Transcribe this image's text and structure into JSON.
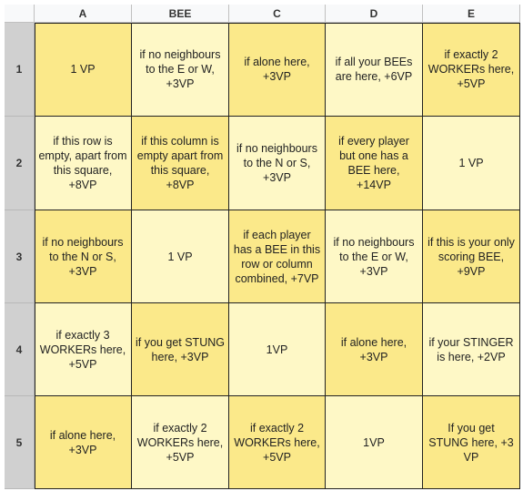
{
  "colors": {
    "dark_yellow": "#fbe98a",
    "light_yellow": "#fef8c6",
    "header_bg": "#f8f9fa",
    "row_header_bg": "#d0d0d0"
  },
  "columns": [
    "A",
    "BEE",
    "C",
    "D",
    "E"
  ],
  "rows": [
    "1",
    "2",
    "3",
    "4",
    "5"
  ],
  "cells": [
    [
      {
        "text": "1 VP",
        "shade": "dark"
      },
      {
        "text": "if no neighbours to the E or W, +3VP",
        "shade": "light"
      },
      {
        "text": "if alone here, +3VP",
        "shade": "dark"
      },
      {
        "text": "if all your BEEs are here, +6VP",
        "shade": "light"
      },
      {
        "text": "if exactly 2 WORKERs here, +5VP",
        "shade": "dark"
      }
    ],
    [
      {
        "text": "if this row is empty, apart from this square, +8VP",
        "shade": "light"
      },
      {
        "text": "if this column is empty apart from this square, +8VP",
        "shade": "dark"
      },
      {
        "text": "if no neighbours to the N or S, +3VP",
        "shade": "light"
      },
      {
        "text": "if every player but one has a BEE here, +14VP",
        "shade": "dark"
      },
      {
        "text": "1 VP",
        "shade": "light"
      }
    ],
    [
      {
        "text": "if no neighbours to the N or S, +3VP",
        "shade": "dark"
      },
      {
        "text": "1 VP",
        "shade": "light"
      },
      {
        "text": "if each player has a BEE in this row or column combined, +7VP",
        "shade": "dark"
      },
      {
        "text": "if no neighbours to the E or W, +3VP",
        "shade": "light"
      },
      {
        "text": "if this is your only scoring BEE, +9VP",
        "shade": "dark"
      }
    ],
    [
      {
        "text": "if exactly 3 WORKERs here, +5VP",
        "shade": "light"
      },
      {
        "text": "if you get STUNG here, +3VP",
        "shade": "dark"
      },
      {
        "text": "1VP",
        "shade": "light"
      },
      {
        "text": "if alone here, +3VP",
        "shade": "dark"
      },
      {
        "text": "if your STINGER is here, +2VP",
        "shade": "light"
      }
    ],
    [
      {
        "text": "if alone here, +3VP",
        "shade": "dark"
      },
      {
        "text": "if exactly 2 WORKERs here, +5VP",
        "shade": "light"
      },
      {
        "text": "if exactly 2 WORKERs here, +5VP",
        "shade": "dark"
      },
      {
        "text": "1VP",
        "shade": "light"
      },
      {
        "text": "If you get STUNG here, +3 VP",
        "shade": "dark"
      }
    ]
  ]
}
